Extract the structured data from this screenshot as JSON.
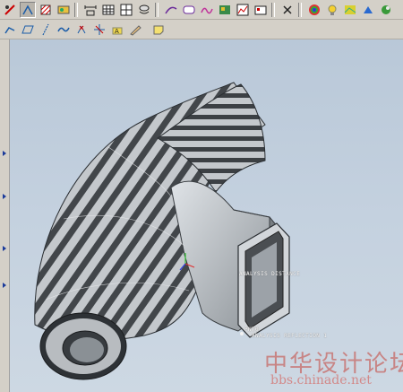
{
  "toolbar_top": {
    "icons": [
      "trim-tool-icon",
      "sketch-tool-icon",
      "hatch-tool-icon",
      "palette-tool-icon",
      "dimension-icon",
      "table-icon",
      "grid-icon",
      "layer-icon",
      "measure-icon",
      "curvature-icon",
      "shade-analysis-icon",
      "surface-display-icon",
      "graph-icon",
      "render-icon",
      "close-icon",
      "color-wheel-icon",
      "light-bulb-icon",
      "scene-icon",
      "camera-icon",
      "appearance-icon"
    ]
  },
  "toolbar_second": {
    "icons": [
      "line-icon",
      "rectangle-icon",
      "construction-line-icon",
      "spline-icon",
      "point-icon",
      "split-icon",
      "text-icon",
      "sketch-mode-icon",
      "note-icon"
    ]
  },
  "viewport": {
    "annotations": {
      "distance_label": "ANALYSIS DISTANCE",
      "point_label": "PNT0",
      "reflection_label": "ANALYSIS REFLECTION 1"
    }
  },
  "watermark": {
    "site_chinese": "中华设计论坛",
    "site_url": "bbs.chinade.net"
  },
  "colors": {
    "ui_face": "#d4d0c8",
    "viewport_bg": "#c4d1df",
    "stripe_dark": "#3f4347",
    "stripe_light": "#c2c6ca",
    "watermark": "#c88585"
  }
}
